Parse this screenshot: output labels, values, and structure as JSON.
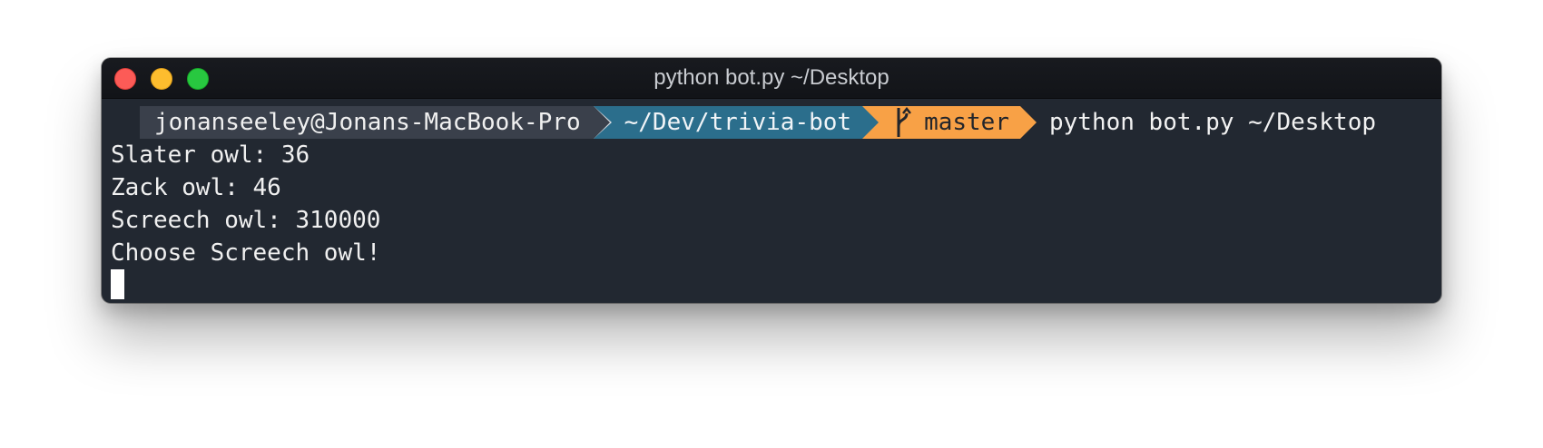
{
  "window": {
    "title": "python bot.py ~/Desktop"
  },
  "prompt": {
    "user_host": "jonanseeley@Jonans-MacBook-Pro",
    "path": "~/Dev/trivia-bot",
    "branch": "master",
    "command": "python bot.py ~/Desktop"
  },
  "output": [
    "Slater owl: 36",
    "Zack owl: 46",
    "Screech owl: 310000",
    "Choose Screech owl!"
  ],
  "colors": {
    "terminal_bg": "#222831",
    "segment_user": "#3a404b",
    "segment_path": "#2b6e8c",
    "segment_git": "#f8a146"
  },
  "icons": [
    "close-icon",
    "minimize-icon",
    "maximize-icon",
    "git-branch-icon"
  ]
}
